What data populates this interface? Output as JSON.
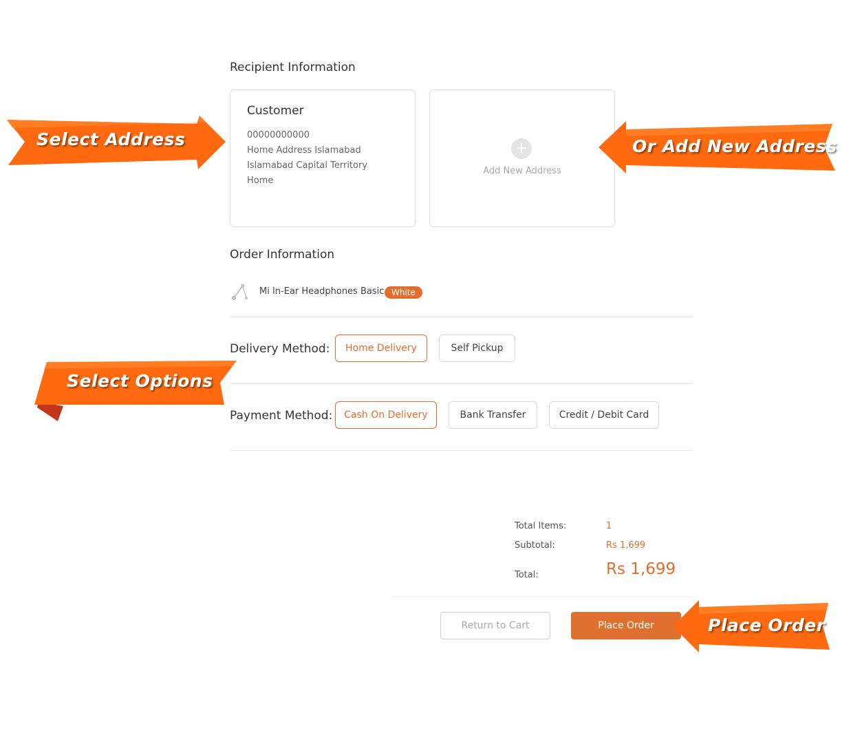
{
  "recipient": {
    "title": "Recipient Information",
    "address": {
      "name": "Customer",
      "phone": "00000000000",
      "line1": "Home Address Islamabad",
      "line2": "Islamabad Capital Territory",
      "label": "Home"
    },
    "add_new_label": "Add New Address"
  },
  "order": {
    "title": "Order Information",
    "product_name": "Mi In-Ear Headphones Basic",
    "product_color": "White"
  },
  "delivery": {
    "label": "Delivery Method:",
    "options": [
      "Home Delivery",
      "Self Pickup"
    ],
    "selected": "Home Delivery"
  },
  "payment": {
    "label": "Payment Method:",
    "options": [
      "Cash On Delivery",
      "Bank Transfer",
      "Credit / Debit Card"
    ],
    "selected": "Cash On Delivery"
  },
  "summary": {
    "total_items_label": "Total Items:",
    "total_items": "1",
    "subtotal_label": "Subtotal:",
    "subtotal": "Rs 1,699",
    "total_label": "Total:",
    "total": "Rs 1,699"
  },
  "actions": {
    "return_label": "Return to Cart",
    "place_label": "Place Order"
  },
  "callouts": {
    "select_address": "Select Address",
    "add_new_address": "Or Add New Address",
    "select_options": "Select Options",
    "place_order": "Place Order"
  },
  "colors": {
    "accent": "#e46c2c",
    "callout": "#ff6a10"
  }
}
